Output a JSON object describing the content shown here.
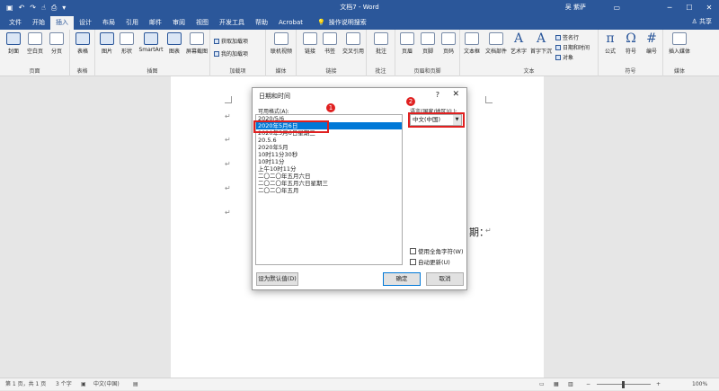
{
  "title_bar": {
    "title": "文档7 - Word",
    "user": "吴 紫萨",
    "quick_access": [
      "save-icon",
      "undo-icon",
      "redo-icon",
      "touch-icon",
      "print-icon",
      "customize-icon"
    ]
  },
  "tabs": [
    {
      "label": "文件",
      "active": false
    },
    {
      "label": "开始",
      "active": false
    },
    {
      "label": "插入",
      "active": true
    },
    {
      "label": "设计",
      "active": false
    },
    {
      "label": "布局",
      "active": false
    },
    {
      "label": "引用",
      "active": false
    },
    {
      "label": "邮件",
      "active": false
    },
    {
      "label": "审阅",
      "active": false
    },
    {
      "label": "视图",
      "active": false
    },
    {
      "label": "开发工具",
      "active": false
    },
    {
      "label": "帮助",
      "active": false
    },
    {
      "label": "Acrobat",
      "active": false
    }
  ],
  "tell_me": "操作说明搜索",
  "share": "共享",
  "ribbon": {
    "pages": {
      "label": "页面",
      "buttons": [
        "封面",
        "空白页",
        "分页"
      ]
    },
    "tables": {
      "label": "表格",
      "buttons": [
        "表格"
      ]
    },
    "illustrations": {
      "label": "插图",
      "buttons": [
        "图片",
        "形状",
        "SmartArt",
        "图表",
        "屏幕截图"
      ]
    },
    "addins": {
      "label": "加载项",
      "items": [
        "获取加载项",
        "我的加载项"
      ]
    },
    "media": {
      "label": "媒体",
      "buttons": [
        "联机视频"
      ]
    },
    "links": {
      "label": "链接",
      "buttons": [
        "链接",
        "书签",
        "交叉引用"
      ]
    },
    "comments": {
      "label": "批注",
      "buttons": [
        "批注"
      ]
    },
    "header_footer": {
      "label": "页眉和页脚",
      "buttons": [
        "页眉",
        "页脚",
        "页码"
      ]
    },
    "text": {
      "label": "文本",
      "buttons": [
        "文本框",
        "文档部件",
        "艺术字",
        "首字下沉"
      ],
      "small": [
        "签名行",
        "日期和时间",
        "对象"
      ]
    },
    "symbols": {
      "label": "符号",
      "buttons": [
        "公式",
        "符号",
        "编号"
      ]
    },
    "embed": {
      "label": "媒体",
      "buttons": [
        "插入媒体"
      ]
    }
  },
  "document": {
    "date_suffix": "期：",
    "paragraph_mark": "↵"
  },
  "dialog": {
    "title": "日期和时间",
    "help": "?",
    "formats_label": "可用格式(A):",
    "language_label": "语言(国家/地区)(L):",
    "formats": [
      "2020/5/6",
      "2020年5月6日",
      "2020年5月6日星期三",
      "20.5.6",
      "2020年5月",
      "10时11分30秒",
      "10时11分",
      "上午10时11分",
      "二〇二〇年五月六日",
      "二〇二〇年五月六日星期三",
      "二〇二〇年五月"
    ],
    "selected_index": 1,
    "language_value": "中文(中国)",
    "use_fullwidth": "使用全角字符(W)",
    "auto_update": "自动更新(U)",
    "set_default": "设为默认值(D)",
    "ok": "确定",
    "cancel": "取消",
    "badge1": "1",
    "badge2": "2"
  },
  "status_bar": {
    "page": "第 1 页，共 1 页",
    "words": "3 个字",
    "language": "中文(中国)",
    "zoom": "100%"
  },
  "colors": {
    "accent": "#2b579a",
    "highlight": "#e02020",
    "selection": "#0078d7"
  }
}
